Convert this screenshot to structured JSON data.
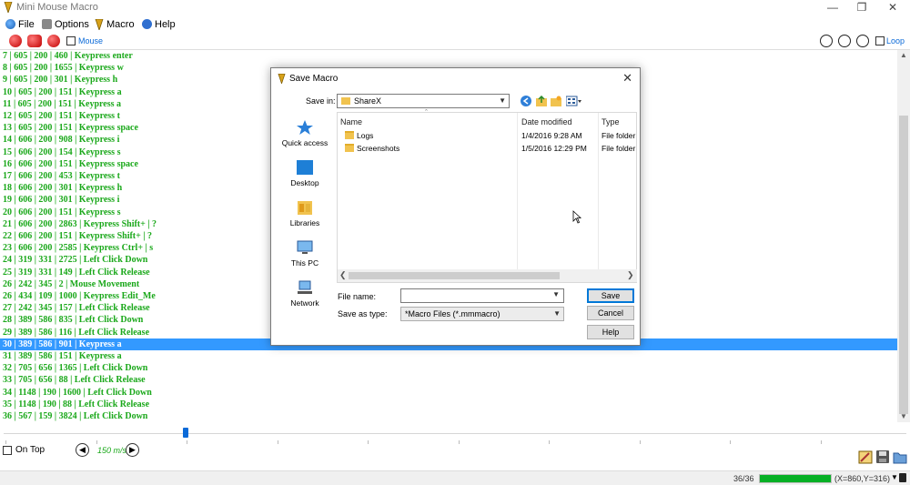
{
  "window": {
    "title": "Mini Mouse Macro"
  },
  "menu": [
    {
      "label": "File",
      "icon": "globe-icon"
    },
    {
      "label": "Options",
      "icon": "gear-icon"
    },
    {
      "label": "Macro",
      "icon": "macro-icon"
    },
    {
      "label": "Help",
      "icon": "help-icon"
    }
  ],
  "toolbar": {
    "mouse_label": "Mouse",
    "loop_label": "Loop"
  },
  "macro_rows": [
    "7 | 605 | 200 | 460 | Keypress enter",
    "8 | 605 | 200 | 1655 | Keypress w",
    "9 | 605 | 200 | 301 | Keypress h",
    "10 | 605 | 200 | 151 | Keypress a",
    "11 | 605 | 200 | 151 | Keypress a",
    "12 | 605 | 200 | 151 | Keypress t",
    "13 | 605 | 200 | 151 | Keypress space",
    "14 | 606 | 200 | 908 | Keypress i",
    "15 | 606 | 200 | 154 | Keypress s",
    "16 | 606 | 200 | 151 | Keypress space",
    "17 | 606 | 200 | 453 | Keypress t",
    "18 | 606 | 200 | 301 | Keypress h",
    "19 | 606 | 200 | 301 | Keypress i",
    "20 | 606 | 200 | 151 | Keypress s",
    "21 | 606 | 200 | 2863 | Keypress Shift+ | ?",
    "22 | 606 | 200 | 151 | Keypress Shift+ | ?",
    "23 | 606 | 200 | 2585 | Keypress Ctrl+ | s",
    "24 | 319 | 331 | 2725 | Left Click Down",
    "25 | 319 | 331 | 149 | Left Click Release",
    "26 | 242 | 345 | 2 | Mouse Movement",
    "26 | 434 | 109 | 1000 | Keypress Edit_Me",
    "27 | 242 | 345 | 157 | Left Click Release",
    "28 | 389 | 586 | 835 | Left Click Down",
    "29 | 389 | 586 | 116 | Left Click Release",
    "30 | 389 | 586 | 901 | Keypress a",
    "31 | 389 | 586 | 151 | Keypress a",
    "32 | 705 | 656 | 1365 | Left Click Down",
    "33 | 705 | 656 | 88 | Left Click Release",
    "34 | 1148 | 190 | 1600 | Left Click Down",
    "35 | 1148 | 190 | 88 | Left Click Release",
    "36 | 567 | 159 | 3824 | Left Click Down"
  ],
  "selected_row": 24,
  "bottom": {
    "on_top_label": "On Top",
    "speed": "150 m/s"
  },
  "status": {
    "count": "36/36",
    "progress": 1.0,
    "coords": "(X=860,Y=316)"
  },
  "dialog": {
    "title": "Save Macro",
    "save_in_label": "Save in:",
    "save_in_value": "ShareX",
    "places": [
      "Quick access",
      "Desktop",
      "Libraries",
      "This PC",
      "Network"
    ],
    "columns": [
      "Name",
      "Date modified",
      "Type"
    ],
    "files": [
      {
        "name": "Logs",
        "date": "1/4/2016 9:28 AM",
        "type": "File folder"
      },
      {
        "name": "Screenshots",
        "date": "1/5/2016 12:29 PM",
        "type": "File folder"
      }
    ],
    "file_name_label": "File name:",
    "file_name_value": "",
    "save_type_label": "Save as type:",
    "save_type_value": "*Macro Files (*.mmmacro)",
    "save_button": "Save",
    "cancel_button": "Cancel",
    "help_button": "Help"
  },
  "colors": {
    "accent": "#3399ff",
    "row_text": "#1aa81a",
    "progress": "#06b025"
  }
}
